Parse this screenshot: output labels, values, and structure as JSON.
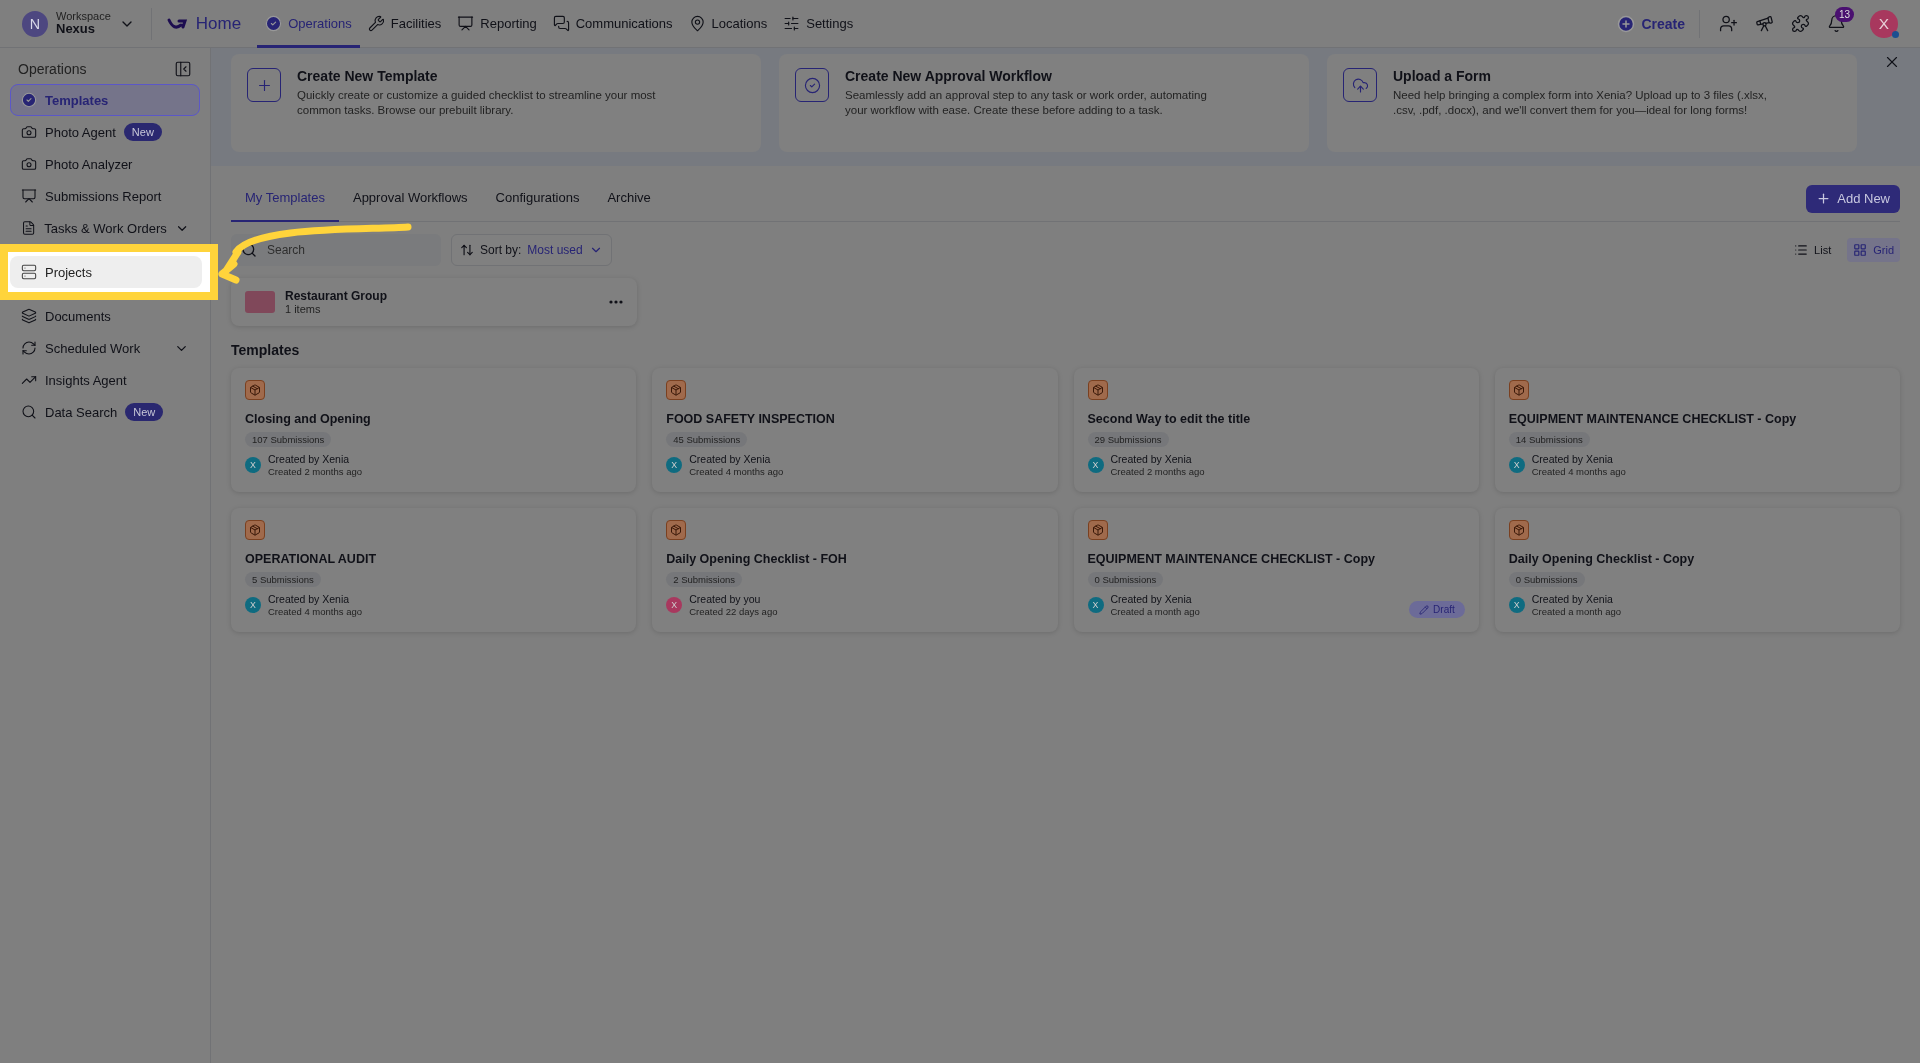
{
  "workspace": {
    "label": "Workspace",
    "name": "Nexus",
    "avatar": "N"
  },
  "home": {
    "label": "Home"
  },
  "nav": [
    {
      "label": "Operations",
      "selected": true
    },
    {
      "label": "Facilities",
      "selected": false
    },
    {
      "label": "Reporting",
      "selected": false
    },
    {
      "label": "Communications",
      "selected": false
    },
    {
      "label": "Locations",
      "selected": false
    },
    {
      "label": "Settings",
      "selected": false
    }
  ],
  "actions": {
    "create": "Create",
    "notifications": "13",
    "avatar": "X"
  },
  "sidebar": {
    "title": "Operations",
    "items": [
      {
        "label": "Templates",
        "selected": true,
        "collapsible": false,
        "highlighted": false
      },
      {
        "label": "Photo Agent",
        "badge": "New",
        "selected": false,
        "collapsible": false,
        "highlighted": false
      },
      {
        "label": "Photo Analyzer",
        "selected": false,
        "collapsible": false,
        "highlighted": false
      },
      {
        "label": "Submissions Report",
        "selected": false,
        "collapsible": false,
        "highlighted": false
      },
      {
        "label": "Tasks & Work Orders",
        "selected": false,
        "collapsible": true,
        "highlighted": false
      },
      {
        "label": "Projects",
        "selected": false,
        "collapsible": false,
        "highlighted": true
      },
      {
        "label": "Documents",
        "selected": false,
        "collapsible": false,
        "highlighted": false
      },
      {
        "label": "Scheduled Work",
        "selected": false,
        "collapsible": true,
        "highlighted": false
      },
      {
        "label": "Insights Agent",
        "selected": false,
        "collapsible": false,
        "highlighted": false
      },
      {
        "label": "Data Search",
        "badge": "New",
        "selected": false,
        "collapsible": false,
        "highlighted": false
      }
    ]
  },
  "banners": [
    {
      "title": "Create New Template",
      "text": "Quickly create or customize a guided checklist to streamline your most common tasks. Browse our prebuilt library."
    },
    {
      "title": "Create New Approval Workflow",
      "text": "Seamlessly add an approval step to any task or work order, automating your workflow with ease. Create these before adding to a task."
    },
    {
      "title": "Upload a Form",
      "text": "Need help bringing a complex form into Xenia? Upload up to 3 files (.xlsx, .csv, .pdf, .docx), and we'll convert them for you—ideal for long forms!"
    }
  ],
  "tabs": [
    {
      "label": "My Templates",
      "selected": true
    },
    {
      "label": "Approval Workflows",
      "selected": false
    },
    {
      "label": "Configurations",
      "selected": false
    },
    {
      "label": "Archive",
      "selected": false
    }
  ],
  "add_button": "Add New",
  "search": {
    "placeholder": "Search"
  },
  "sort": {
    "label": "Sort by:",
    "value": "Most used"
  },
  "views": [
    {
      "label": "List",
      "selected": false
    },
    {
      "label": "Grid",
      "selected": true
    }
  ],
  "folder": {
    "name": "Restaurant Group",
    "count": "1 items"
  },
  "section_title": "Templates",
  "templates": [
    {
      "title": "Closing and Opening",
      "submissions": "107 Submissions",
      "creator": "Created by Xenia",
      "created": "Created 2 months ago",
      "avatar": "X",
      "color": "#0f6b80"
    },
    {
      "title": "FOOD SAFETY INSPECTION",
      "submissions": "45 Submissions",
      "creator": "Created by Xenia",
      "created": "Created 4 months ago",
      "avatar": "X",
      "color": "#0f6b80"
    },
    {
      "title": "Second Way to edit the title",
      "submissions": "29 Submissions",
      "creator": "Created by Xenia",
      "created": "Created 2 months ago",
      "avatar": "X",
      "color": "#0f6b80"
    },
    {
      "title": "EQUIPMENT MAINTENANCE CHECKLIST - Copy",
      "submissions": "14 Submissions",
      "creator": "Created by Xenia",
      "created": "Created 4 months ago",
      "avatar": "X",
      "color": "#0f6b80"
    },
    {
      "title": "OPERATIONAL AUDIT",
      "submissions": "5 Submissions",
      "creator": "Created by Xenia",
      "created": "Created 4 months ago",
      "avatar": "X",
      "color": "#0f6b80"
    },
    {
      "title": "Daily Opening Checklist - FOH",
      "submissions": "2 Submissions",
      "creator": "Created by you",
      "created": "Created 22 days ago",
      "avatar": "X",
      "color": "#a8385e"
    },
    {
      "title": "EQUIPMENT MAINTENANCE CHECKLIST - Copy",
      "submissions": "0 Submissions",
      "creator": "Created by Xenia",
      "created": "Created a month ago",
      "avatar": "X",
      "color": "#0f6b80",
      "badge": "Draft"
    },
    {
      "title": "Daily Opening Checklist - Copy",
      "submissions": "0 Submissions",
      "creator": "Created by Xenia",
      "created": "Created a month ago",
      "avatar": "X",
      "color": "#0f6b80"
    }
  ]
}
